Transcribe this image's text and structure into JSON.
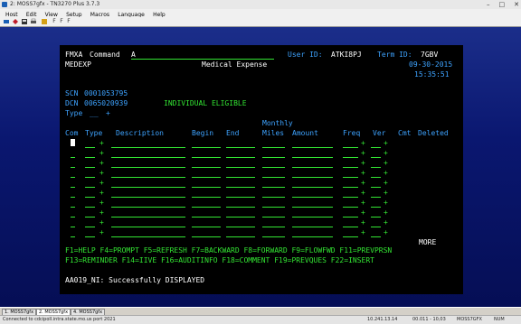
{
  "window": {
    "title": "2: MOSS7gfx - TN3270 Plus 3.7.3",
    "minimize": "–",
    "maximize": "□",
    "close": "✕"
  },
  "menu": [
    "Host",
    "Edit",
    "View",
    "Setup",
    "Macros",
    "Language",
    "Help"
  ],
  "toolbar": {
    "icons": [
      "connect-icon",
      "disconnect-icon",
      "save-icon",
      "print-icon",
      "font-icon",
      "color-icon",
      "font-toggle-icon"
    ],
    "labels": [
      "F",
      "F",
      "F"
    ]
  },
  "screen": {
    "fmxa": "FMXA",
    "command_label": "Command",
    "command_value": "A",
    "user_id_label": "User ID:",
    "user_id": "ATKI8PJ",
    "term_id_label": "Term ID:",
    "term_id": "7GBV",
    "screen_code": "MEDEXP",
    "screen_title": "Medical Expense",
    "date": "09-30-2015",
    "time": "15:35:51",
    "scn_label": "SCN",
    "scn": "0001053795",
    "dcn_label": "DCN",
    "dcn": "0065020939",
    "eligibility": "INDIVIDUAL ELIGIBLE",
    "type_label": "Type",
    "type_value": "__",
    "plus": "+",
    "monthly_label": "Monthly",
    "columns": [
      "Com",
      "Type",
      "Description",
      "Begin",
      "End",
      "Miles",
      "Amount",
      "Freq",
      "Ver",
      "Cmt",
      "Deleted"
    ],
    "more": "MORE",
    "fkeys_line1": "F1=HELP F4=PROMPT F5=REFRESH F7=BACKWARD F8=FORWARD F9=FLOWFWD F11=PREVPRSN",
    "fkeys_line2": "F13=REMINDER F14=IIVE F16=AUDITINFO F18=COMMENT F19=PREVQUES F22=INSERT",
    "message": "AA019_NI: Successfully DISPLAYED"
  },
  "tabs": [
    "1. MOSS7gfx",
    "2. MOSS7gfx",
    "4. MOSS7gfx"
  ],
  "status": {
    "connection": "Connected to cdcipoll.intra.state.mo.us port 2021",
    "ip": "10.241.13.14",
    "position": "00.011 - 10,03",
    "session": "MOSS7GFX",
    "num": "NUM"
  },
  "colors": {
    "green": "#33e533",
    "blue": "#3ea3ff",
    "background": "#000000"
  }
}
